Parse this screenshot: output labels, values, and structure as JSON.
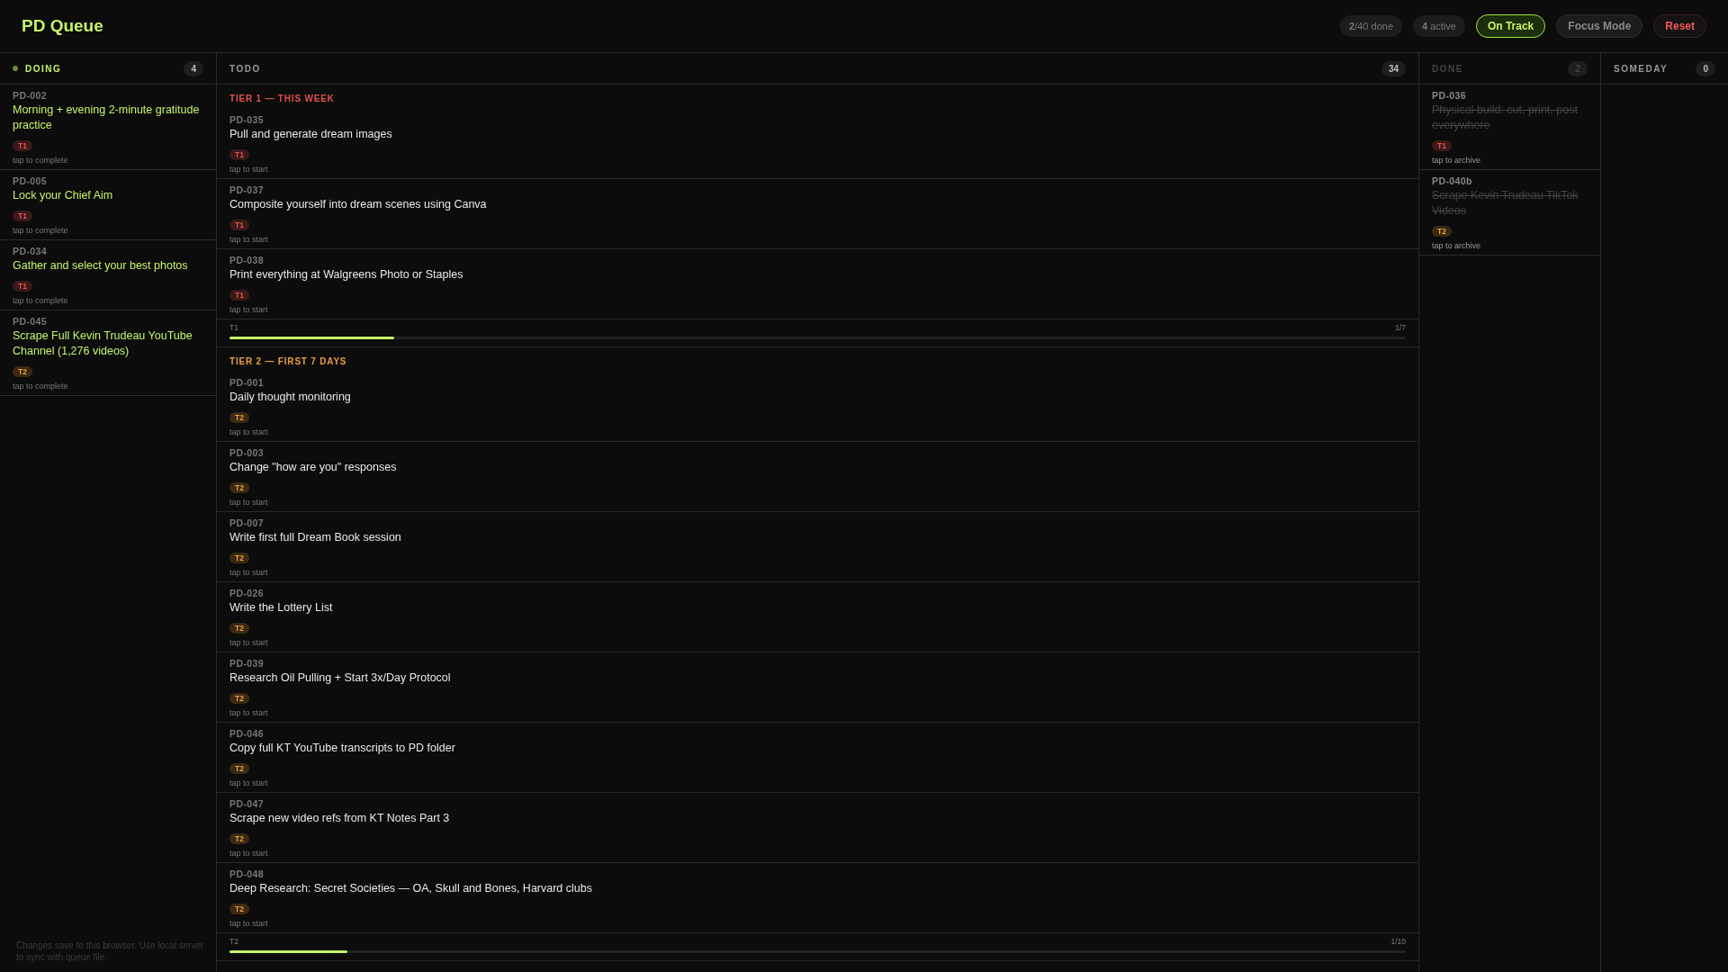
{
  "app_title": "PD Queue",
  "stats": [
    "**2**/40 done",
    "**4** active"
  ],
  "buttons": [
    {
      "label": "On Track",
      "kind": "status",
      "on": true
    },
    {
      "label": "Focus Mode",
      "kind": "toggle",
      "on": false
    },
    {
      "label": "Reset",
      "kind": "danger"
    }
  ],
  "columns": [
    {
      "kind": "doing",
      "title": "DOING",
      "count": "4",
      "groups": [
        {
          "cards": [
            {
              "id": "PD-002",
              "title": "Morning + evening 2-minute gratitude practice",
              "tag": {
                "label": "T1",
                "kind": "tier1"
              },
              "hint": "tap to complete"
            },
            {
              "id": "PD-005",
              "title": "Lock your Chief Aim",
              "tag": {
                "label": "T1",
                "kind": "tier1"
              },
              "hint": "tap to complete"
            },
            {
              "id": "PD-034",
              "title": "Gather and select your best photos",
              "tag": {
                "label": "T1",
                "kind": "tier1"
              },
              "hint": "tap to complete"
            },
            {
              "id": "PD-045",
              "title": "Scrape Full Kevin Trudeau YouTube Channel (1,276 videos)",
              "tag": {
                "label": "T2",
                "kind": "tier2"
              },
              "hint": "tap to complete"
            }
          ]
        }
      ]
    },
    {
      "kind": "todo",
      "title": "TODO",
      "count": "34",
      "groups": [
        {
          "heading": "TIER 1 — THIS WEEK",
          "color": "#e05252",
          "cards": [
            {
              "id": "PD-035",
              "title": "Pull and generate dream images",
              "tag": {
                "label": "T1",
                "kind": "tier1"
              },
              "hint": "tap to start"
            },
            {
              "id": "PD-037",
              "title": "Composite yourself into dream scenes using Canva",
              "tag": {
                "label": "T1",
                "kind": "tier1"
              },
              "hint": "tap to start"
            },
            {
              "id": "PD-038",
              "title": "Print everything at Walgreens Photo or Staples",
              "tag": {
                "label": "T1",
                "kind": "tier1"
              },
              "hint": "tap to start"
            }
          ],
          "progress": {
            "label": "T1",
            "reading": "1/7",
            "level": 0.14
          }
        },
        {
          "heading": "TIER 2 — FIRST 7 DAYS",
          "color": "#e8a040",
          "cards": [
            {
              "id": "PD-001",
              "title": "Daily thought monitoring",
              "tag": {
                "label": "T2",
                "kind": "tier2"
              },
              "hint": "tap to start"
            },
            {
              "id": "PD-003",
              "title": "Change \"how are you\" responses",
              "tag": {
                "label": "T2",
                "kind": "tier2"
              },
              "hint": "tap to start"
            },
            {
              "id": "PD-007",
              "title": "Write first full Dream Book session",
              "tag": {
                "label": "T2",
                "kind": "tier2"
              },
              "hint": "tap to start"
            },
            {
              "id": "PD-026",
              "title": "Write the Lottery List",
              "tag": {
                "label": "T2",
                "kind": "tier2"
              },
              "hint": "tap to start"
            },
            {
              "id": "PD-039",
              "title": "Research Oil Pulling + Start 3x/Day Protocol",
              "tag": {
                "label": "T2",
                "kind": "tier2"
              },
              "hint": "tap to start"
            },
            {
              "id": "PD-046",
              "title": "Copy full KT YouTube transcripts to PD folder",
              "tag": {
                "label": "T2",
                "kind": "tier2"
              },
              "hint": "tap to start"
            },
            {
              "id": "PD-047",
              "title": "Scrape new video refs from KT Notes Part 3",
              "tag": {
                "label": "T2",
                "kind": "tier2"
              },
              "hint": "tap to start"
            },
            {
              "id": "PD-048",
              "title": "Deep Research: Secret Societies — OA, Skull and Bones, Harvard clubs",
              "tag": {
                "label": "T2",
                "kind": "tier2"
              },
              "hint": "tap to start"
            }
          ],
          "progress": {
            "label": "T2",
            "reading": "1/10",
            "level": 0.1
          }
        }
      ]
    },
    {
      "kind": "done",
      "title": "DONE",
      "count": "2",
      "groups": [
        {
          "cards": [
            {
              "id": "PD-036",
              "title": "Physical build: cut, print, post everywhere",
              "tag": {
                "label": "T1",
                "kind": "tier1"
              },
              "hint": "tap to archive"
            },
            {
              "id": "PD-040b",
              "title": "Scrape Kevin Trudeau TikTok Videos",
              "tag": {
                "label": "T2",
                "kind": "tier2"
              },
              "hint": "tap to archive"
            }
          ]
        }
      ]
    },
    {
      "kind": "someday",
      "title": "SOMEDAY",
      "count": "0"
    }
  ],
  "footer_note": "Changes save to this browser. Use local server to sync with queue file."
}
